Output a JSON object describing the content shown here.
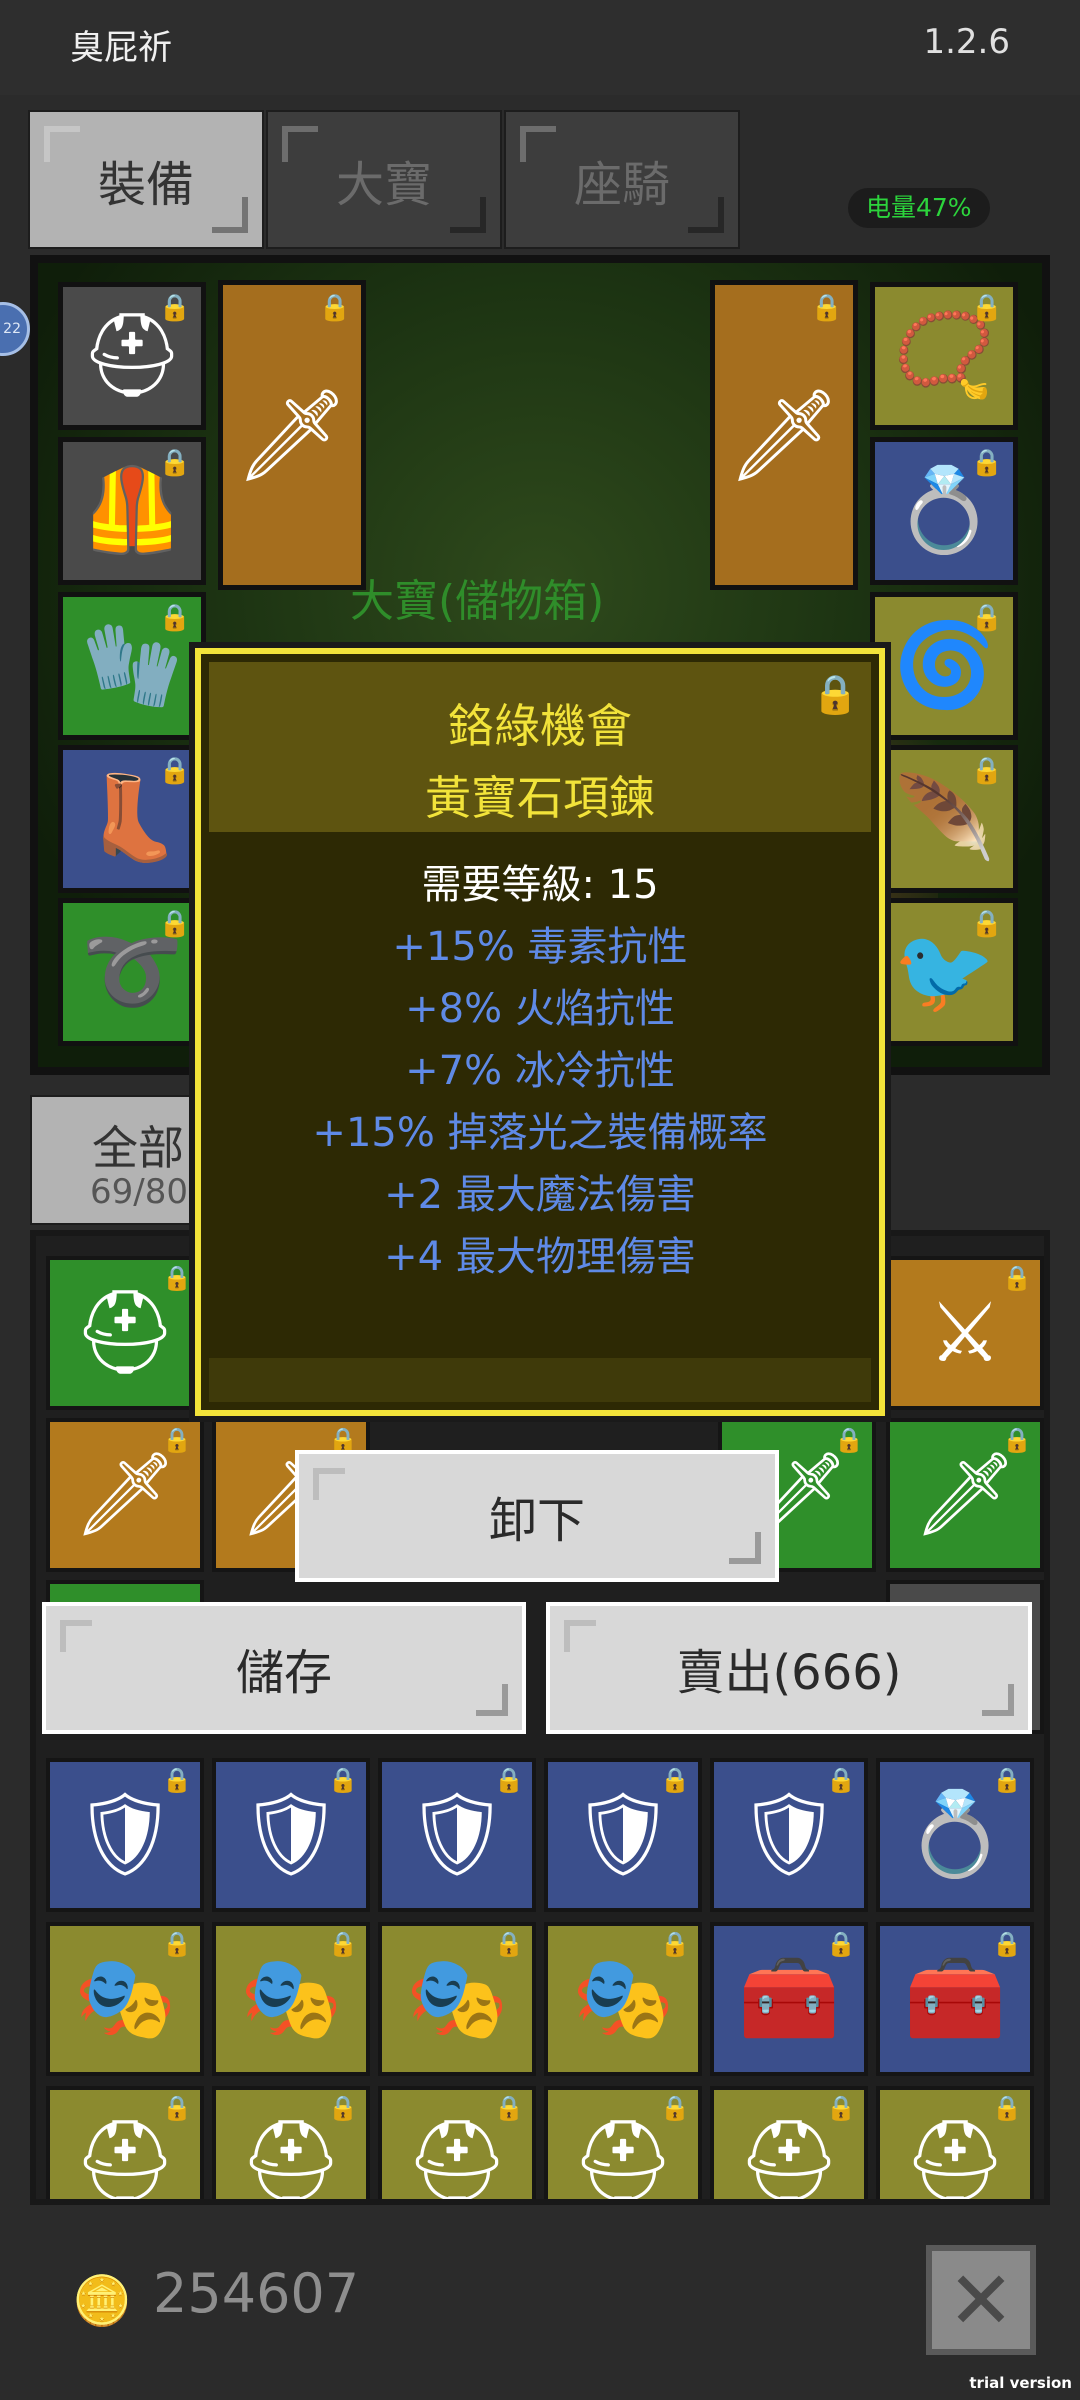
{
  "header": {
    "title": "臭屁祈",
    "version": "1.2.6"
  },
  "tabs": [
    {
      "label": "裝備",
      "active": true
    },
    {
      "label": "大寶",
      "active": false
    },
    {
      "label": "座騎",
      "active": false
    }
  ],
  "battery": "电量47%",
  "scene": {
    "storage_label": "大寶(儲物箱)"
  },
  "filter": {
    "label": "全部",
    "count": "69/80"
  },
  "tooltip": {
    "set_name": "鉻綠機會",
    "item_name": "黃寶石項鍊",
    "requirement": "需要等級: 15",
    "stats": [
      "+15% 毒素抗性",
      "+8% 火焰抗性",
      "+7% 冰冷抗性",
      "+15% 掉落光之裝備概率",
      "+2 最大魔法傷害",
      "+4 最大物理傷害"
    ]
  },
  "actions": {
    "unequip": "卸下",
    "store": "儲存",
    "sell": "賣出(666)"
  },
  "footer": {
    "gold": "254607"
  },
  "watermark": "trial version",
  "colors": {
    "tooltip_border": "#f2e33a",
    "stat_text": "#5f8ae6",
    "battery_text": "#2cd43c"
  }
}
